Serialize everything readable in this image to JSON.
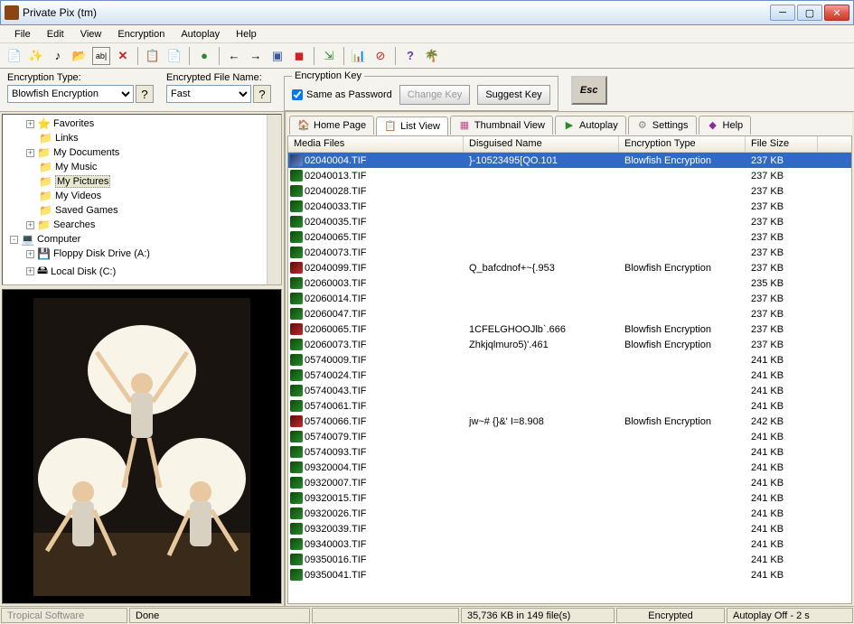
{
  "window": {
    "title": "Private Pix (tm)"
  },
  "menu": [
    "File",
    "Edit",
    "View",
    "Encryption",
    "Autoplay",
    "Help"
  ],
  "options": {
    "encTypeLabel": "Encryption Type:",
    "encType": "Blowfish Encryption",
    "fileNameLabel": "Encrypted File Name:",
    "fileName": "Fast",
    "keyLegend": "Encryption Key",
    "sameAsPwd": "Same as Password",
    "changeKey": "Change Key",
    "suggestKey": "Suggest Key",
    "esc": "Esc"
  },
  "tree": [
    {
      "indent": 1,
      "exp": "+",
      "icon": "⭐",
      "label": "Favorites",
      "color": "#f0c040"
    },
    {
      "indent": 1,
      "exp": "",
      "icon": "📁",
      "label": "Links",
      "color": "#f0c040"
    },
    {
      "indent": 1,
      "exp": "+",
      "icon": "📁",
      "label": "My Documents",
      "color": "#f0c040"
    },
    {
      "indent": 1,
      "exp": "",
      "icon": "📁",
      "label": "My Music",
      "color": "#f0c040"
    },
    {
      "indent": 1,
      "exp": "",
      "icon": "📁",
      "label": "My Pictures",
      "color": "#f0c040",
      "selected": true
    },
    {
      "indent": 1,
      "exp": "",
      "icon": "📁",
      "label": "My Videos",
      "color": "#f0c040"
    },
    {
      "indent": 1,
      "exp": "",
      "icon": "📁",
      "label": "Saved Games",
      "color": "#6aa84f"
    },
    {
      "indent": 1,
      "exp": "+",
      "icon": "📁",
      "label": "Searches",
      "color": "#6aa84f"
    },
    {
      "indent": 0,
      "exp": "-",
      "icon": "💻",
      "label": "Computer",
      "color": "#888"
    },
    {
      "indent": 1,
      "exp": "+",
      "icon": "💾",
      "label": "Floppy Disk Drive (A:)",
      "color": "#888"
    },
    {
      "indent": 1,
      "exp": "+",
      "icon": "🖴",
      "label": "Local Disk (C:)",
      "color": "#888"
    }
  ],
  "tabs": [
    {
      "icon": "🏠",
      "label": "Home Page",
      "color": "#d98c3a"
    },
    {
      "icon": "📋",
      "label": "List View",
      "active": true,
      "color": "#c04a8a"
    },
    {
      "icon": "▦",
      "label": "Thumbnail View",
      "color": "#c04a8a"
    },
    {
      "icon": "▶",
      "label": "Autoplay",
      "color": "#2a8a2a"
    },
    {
      "icon": "⚙",
      "label": "Settings",
      "color": "#888"
    },
    {
      "icon": "◆",
      "label": "Help",
      "color": "#8a2aa0"
    }
  ],
  "columns": [
    "Media Files",
    "Disguised Name",
    "Encryption Type",
    "File Size"
  ],
  "files": [
    {
      "name": "02040004.TIF",
      "disg": "}-10523495[QO.101",
      "enc": "Blowfish Encryption",
      "size": "237 KB",
      "selected": true,
      "ic": "sel"
    },
    {
      "name": "02040013.TIF",
      "disg": "",
      "enc": "",
      "size": "237 KB",
      "ic": "green"
    },
    {
      "name": "02040028.TIF",
      "disg": "",
      "enc": "",
      "size": "237 KB",
      "ic": "green"
    },
    {
      "name": "02040033.TIF",
      "disg": "",
      "enc": "",
      "size": "237 KB",
      "ic": "green"
    },
    {
      "name": "02040035.TIF",
      "disg": "",
      "enc": "",
      "size": "237 KB",
      "ic": "green"
    },
    {
      "name": "02040065.TIF",
      "disg": "",
      "enc": "",
      "size": "237 KB",
      "ic": "green"
    },
    {
      "name": "02040073.TIF",
      "disg": "",
      "enc": "",
      "size": "237 KB",
      "ic": "green"
    },
    {
      "name": "02040099.TIF",
      "disg": "Q_bafcdnof+~{.953",
      "enc": "Blowfish Encryption",
      "size": "237 KB",
      "ic": "red"
    },
    {
      "name": "02060003.TIF",
      "disg": "",
      "enc": "",
      "size": "235 KB",
      "ic": "green"
    },
    {
      "name": "02060014.TIF",
      "disg": "",
      "enc": "",
      "size": "237 KB",
      "ic": "green"
    },
    {
      "name": "02060047.TIF",
      "disg": "",
      "enc": "",
      "size": "237 KB",
      "ic": "green"
    },
    {
      "name": "02060065.TIF",
      "disg": "1CFELGHOOJlb`.666",
      "enc": "Blowfish Encryption",
      "size": "237 KB",
      "ic": "red"
    },
    {
      "name": "02060073.TIF",
      "disg": "Zhkjqlmuro5)'.461",
      "enc": "Blowfish Encryption",
      "size": "237 KB",
      "ic": "green"
    },
    {
      "name": "05740009.TIF",
      "disg": "",
      "enc": "",
      "size": "241 KB",
      "ic": "green"
    },
    {
      "name": "05740024.TIF",
      "disg": "",
      "enc": "",
      "size": "241 KB",
      "ic": "green"
    },
    {
      "name": "05740043.TIF",
      "disg": "",
      "enc": "",
      "size": "241 KB",
      "ic": "green"
    },
    {
      "name": "05740061.TIF",
      "disg": "",
      "enc": "",
      "size": "241 KB",
      "ic": "green"
    },
    {
      "name": "05740066.TIF",
      "disg": "jw~# {}&' I=8.908",
      "enc": "Blowfish Encryption",
      "size": "242 KB",
      "ic": "red"
    },
    {
      "name": "05740079.TIF",
      "disg": "",
      "enc": "",
      "size": "241 KB",
      "ic": "green"
    },
    {
      "name": "05740093.TIF",
      "disg": "",
      "enc": "",
      "size": "241 KB",
      "ic": "green"
    },
    {
      "name": "09320004.TIF",
      "disg": "",
      "enc": "",
      "size": "241 KB",
      "ic": "green"
    },
    {
      "name": "09320007.TIF",
      "disg": "",
      "enc": "",
      "size": "241 KB",
      "ic": "green"
    },
    {
      "name": "09320015.TIF",
      "disg": "",
      "enc": "",
      "size": "241 KB",
      "ic": "green"
    },
    {
      "name": "09320026.TIF",
      "disg": "",
      "enc": "",
      "size": "241 KB",
      "ic": "green"
    },
    {
      "name": "09320039.TIF",
      "disg": "",
      "enc": "",
      "size": "241 KB",
      "ic": "green"
    },
    {
      "name": "09340003.TIF",
      "disg": "",
      "enc": "",
      "size": "241 KB",
      "ic": "green"
    },
    {
      "name": "09350016.TIF",
      "disg": "",
      "enc": "",
      "size": "241 KB",
      "ic": "green"
    },
    {
      "name": "09350041.TIF",
      "disg": "",
      "enc": "",
      "size": "241 KB",
      "ic": "green"
    }
  ],
  "status": {
    "brand": "Tropical Software",
    "done": "Done",
    "summary": "35,736 KB in 149 file(s)",
    "encrypted": "Encrypted",
    "autoplay": "Autoplay  Off - 2 s"
  }
}
